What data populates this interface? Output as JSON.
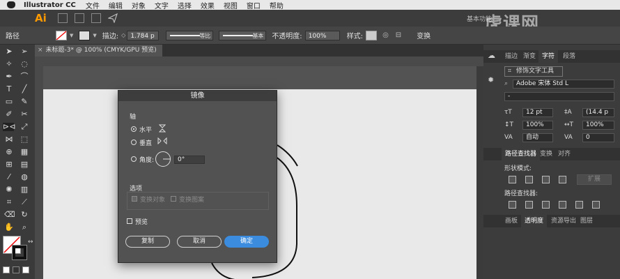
{
  "menubar": {
    "app_name": "Illustrator CC",
    "items": [
      "文件",
      "编辑",
      "对象",
      "文字",
      "选择",
      "效果",
      "视图",
      "窗口",
      "帮助"
    ]
  },
  "appbar": {
    "logo": "Ai",
    "workspace": "基本功能"
  },
  "control_bar": {
    "selection_label": "路径",
    "stroke_label": "描边:",
    "stroke_weight": "1.784 p",
    "stroke_profile": "等比",
    "brush": "基本",
    "opacity_label": "不透明度:",
    "opacity_value": "100%",
    "style_label": "样式:",
    "transform_label": "变换"
  },
  "document_tab": {
    "title": "未标题-3* @ 100% (CMYK/GPU 预览)"
  },
  "dialog": {
    "title": "镜像",
    "axis_label": "轴",
    "horizontal": "水平",
    "vertical": "垂直",
    "angle_label": "角度:",
    "angle_value": "0°",
    "selected_axis": "水平",
    "options_label": "选项",
    "transform_objects": "变换对象",
    "transform_patterns": "变换图案",
    "preview_label": "预览",
    "copy_button": "复制",
    "cancel_button": "取消",
    "ok_button": "确定"
  },
  "right_panel": {
    "top_tabs": [
      "描边",
      "渐变",
      "字符",
      "段落"
    ],
    "active_top_tab": "字符",
    "touch_type_tool": "修饰文字工具",
    "font_family": "Adobe 宋体 Std L",
    "font_style": "-",
    "font_size": "12 pt",
    "leading": "(14.4 p",
    "vertical_scale": "100%",
    "horizontal_scale": "100%",
    "kerning": "自动",
    "tracking": "0",
    "mid_tabs": [
      "路径查找器",
      "变换",
      "对齐"
    ],
    "active_mid_tab": "路径查找器",
    "shape_modes_label": "形状模式:",
    "expand_button": "扩展",
    "pathfinders_label": "路径查找器:",
    "bottom_tabs": [
      "画板",
      "透明度",
      "资源导出",
      "图层"
    ],
    "active_bottom_tab": "透明度"
  },
  "watermark": "虎课网",
  "colors": {
    "accent": "#3b8cde",
    "app_logo": "#ff9a00"
  }
}
